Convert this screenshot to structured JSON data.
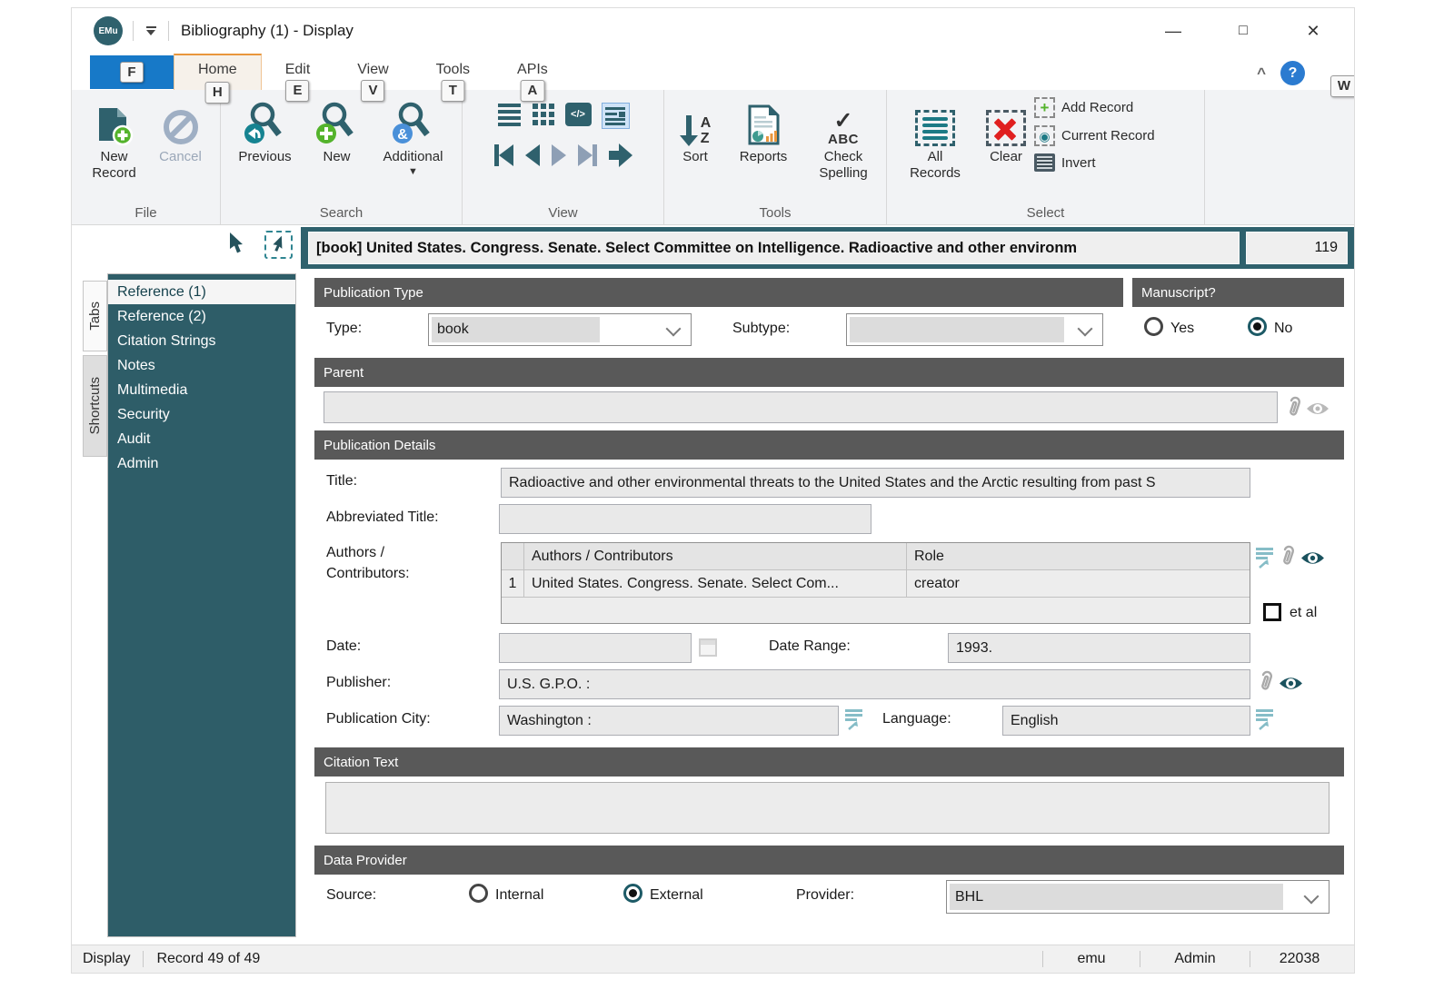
{
  "titlebar": {
    "logo": "EMu",
    "title": "Bibliography (1) - Display"
  },
  "glyphs": {
    "minimize": "—",
    "maximize": "□",
    "close": "✕",
    "collapse_ribbon": "^",
    "help": "?",
    "dropdown_small": "▼",
    "amp": "&",
    "code": "</>",
    "check": "✓",
    "plus": "+",
    "target": "◉"
  },
  "ribbon": {
    "active_tab": "Home",
    "file_tab": {
      "keytip": "F"
    },
    "tabs": [
      {
        "label": "Home",
        "keytip": "H"
      },
      {
        "label": "Edit",
        "keytip": "E"
      },
      {
        "label": "View",
        "keytip": "V"
      },
      {
        "label": "Tools",
        "keytip": "T"
      },
      {
        "label": "APIs",
        "keytip": "A"
      }
    ],
    "help_keytip": "W",
    "groups": {
      "file": {
        "label": "File",
        "new_record": "New Record",
        "cancel": "Cancel"
      },
      "search": {
        "label": "Search",
        "previous": "Previous",
        "new": "New",
        "additional": "Additional"
      },
      "view": {
        "label": "View"
      },
      "tools": {
        "label": "Tools",
        "sort": "Sort",
        "reports": "Reports",
        "check_spelling": "Check Spelling",
        "sort_a": "A",
        "sort_z": "Z",
        "abc": "ABC"
      },
      "select": {
        "label": "Select",
        "all_records": "All Records",
        "clear": "Clear",
        "add_record": "Add Record",
        "current_record": "Current Record",
        "invert": "Invert"
      }
    }
  },
  "record_header": {
    "summary": "[book] United States. Congress. Senate. Select Committee on Intelligence. Radioactive and other environm",
    "number": "119"
  },
  "sidebar": {
    "tabs": [
      {
        "label": "Tabs"
      },
      {
        "label": "Shortcuts"
      }
    ],
    "selected": "Reference (1)",
    "items": [
      {
        "label": "Reference (1)"
      },
      {
        "label": "Reference (2)"
      },
      {
        "label": "Citation Strings"
      },
      {
        "label": "Notes"
      },
      {
        "label": "Multimedia"
      },
      {
        "label": "Security"
      },
      {
        "label": "Audit"
      },
      {
        "label": "Admin"
      }
    ]
  },
  "form": {
    "publication_type": {
      "header": "Publication Type",
      "type_label": "Type:",
      "type_value": "book",
      "subtype_label": "Subtype:",
      "subtype_value": ""
    },
    "manuscript": {
      "header": "Manuscript?",
      "yes_label": "Yes",
      "no_label": "No",
      "selected": "No"
    },
    "parent": {
      "header": "Parent",
      "value": ""
    },
    "publication_details": {
      "header": "Publication Details",
      "title_label": "Title:",
      "title_value": "Radioactive and other environmental threats to the United States and the Arctic resulting from past S",
      "abbreviated_title_label": "Abbreviated Title:",
      "abbreviated_title_value": "",
      "authors_label": "Authors /\nContributors:",
      "authors_table": {
        "headers": {
          "num": "",
          "authors": "Authors / Contributors",
          "role": "Role"
        },
        "rows": [
          {
            "num": "1",
            "authors": "United States. Congress. Senate. Select Com...",
            "role": "creator"
          }
        ]
      },
      "et_al_label": "et al",
      "date_label": "Date:",
      "date_value": "",
      "date_range_label": "Date Range:",
      "date_range_value": "1993.",
      "publisher_label": "Publisher:",
      "publisher_value": "U.S. G.P.O. :",
      "publication_city_label": "Publication City:",
      "publication_city_value": "Washington :",
      "language_label": "Language:",
      "language_value": "English"
    },
    "citation": {
      "header": "Citation Text",
      "value": ""
    },
    "data_provider": {
      "header": "Data Provider",
      "source_label": "Source:",
      "internal_label": "Internal",
      "external_label": "External",
      "selected": "External",
      "provider_label": "Provider:",
      "provider_value": "BHL"
    }
  },
  "status_bar": {
    "mode": "Display",
    "record_position": "Record 49 of 49",
    "database": "emu",
    "user": "Admin",
    "session": "22038"
  },
  "colors": {
    "teal": "#2F616D",
    "header_gray": "#595959",
    "file_tab_blue": "#1779C8",
    "active_tab_orange": "#E8963C",
    "green": "#54B32C",
    "blue_badge": "#4A90D9",
    "red": "#E01F1F"
  }
}
